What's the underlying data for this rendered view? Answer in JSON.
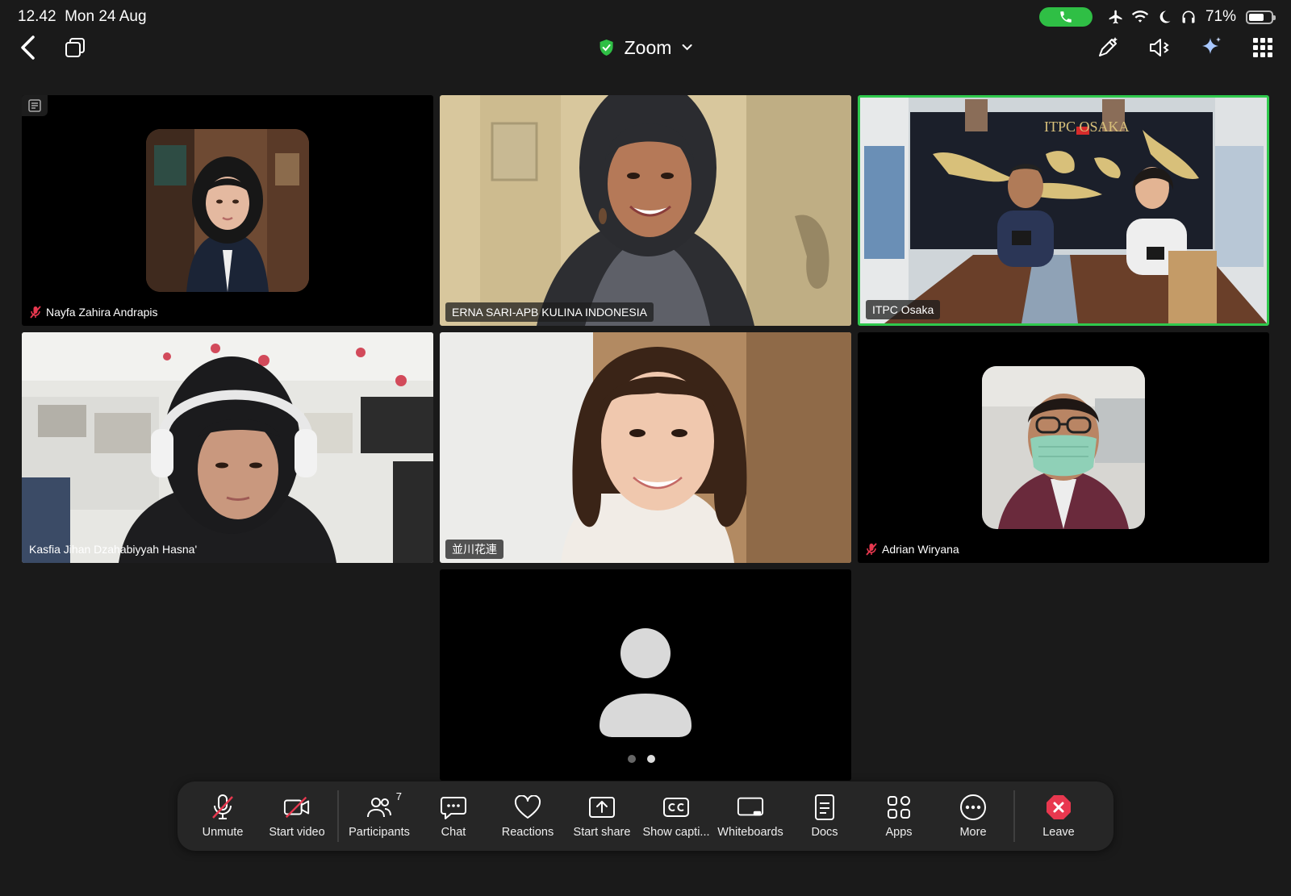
{
  "status_bar": {
    "time": "12.42",
    "date": "Mon 24 Aug",
    "battery_pct": "71%",
    "battery_level": 0.71,
    "call_color": "#2fbf45"
  },
  "header": {
    "title": "Zoom",
    "security_color": "#2fbf45",
    "icons": [
      "back-icon",
      "picture-in-picture-icon",
      "annotate-icon",
      "speaker-icon",
      "ai-companion-icon",
      "grid-view-icon"
    ]
  },
  "tiles": [
    {
      "name": "Nayfa Zahira Andrapis",
      "muted": true
    },
    {
      "name": "ERNA SARI-APB KULINA INDONESIA",
      "muted": false
    },
    {
      "name": "ITPC Osaka",
      "muted": false,
      "active": true,
      "sign": "ITPC OSAKA"
    },
    {
      "name": "Kasfia Jihan Dzahabiyyah Hasna'",
      "muted": false
    },
    {
      "name": "並川花連",
      "muted": false
    },
    {
      "name": "Adrian Wiryana",
      "muted": true
    },
    {
      "name": "",
      "muted": false
    }
  ],
  "pagination": {
    "pages": 2,
    "current": 2
  },
  "toolbar": {
    "unmute": "Unmute",
    "start_video": "Start video",
    "participants": "Participants",
    "participants_count": "7",
    "chat": "Chat",
    "reactions": "Reactions",
    "start_share": "Start share",
    "captions": "Show capti...",
    "whiteboards": "Whiteboards",
    "docs": "Docs",
    "apps": "Apps",
    "more": "More",
    "leave": "Leave",
    "leave_color": "#e8384f"
  },
  "colors": {
    "active_speaker": "#2fc94d",
    "mute_red": "#e8384f"
  }
}
